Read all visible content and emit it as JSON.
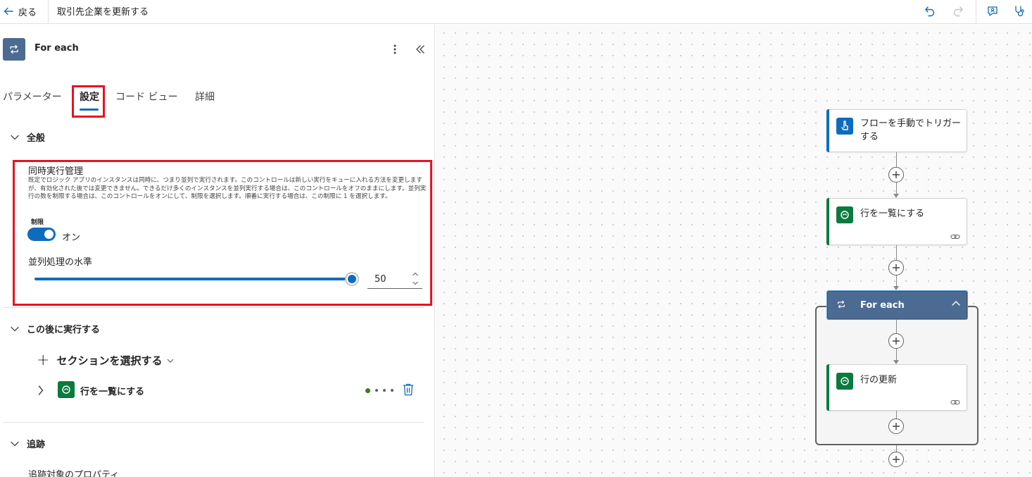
{
  "topbar": {
    "back_label": "戻る",
    "flow_title": "取引先企業を更新する",
    "icons": [
      "undo-icon",
      "redo-icon",
      "feedback-icon",
      "flow-checker-icon"
    ]
  },
  "panel": {
    "action_title": "For each",
    "tabs": [
      {
        "label": "パラメーター"
      },
      {
        "label": "設定"
      },
      {
        "label": "コード ビュー"
      },
      {
        "label": "詳細"
      }
    ],
    "active_tab": "設定",
    "general": {
      "header": "全般",
      "concurrency_title": "同時実行管理",
      "concurrency_desc": "既定でロジック アプリのインスタンスは同時に、つまり並列で実行されます。このコントロールは新しい実行をキューに入れる方法を変更しますが、有効化された後では変更できません。できるだけ多くのインスタンスを並列実行する場合は、このコントロールをオフのままにします。並列実行の数を制限する場合は、このコントロールをオンにして、制限を選択します。順番に実行する場合は、この制限に 1 を選択します。",
      "limit_label": "制限",
      "toggle_state": "オン",
      "toggle_on": true,
      "parallelism_label": "並列処理の水準",
      "parallelism_value": "50",
      "parallelism_fraction": 1.0
    },
    "run_after": {
      "header": "この後に実行する",
      "add_section_label": "セクションを選択する",
      "items": [
        {
          "label": "行を一覧にする"
        }
      ]
    },
    "tracking": {
      "header": "追跡",
      "tracked_properties_label": "追跡対象のプロパティ"
    }
  },
  "canvas": {
    "nodes": {
      "trigger": {
        "label": "フローを手動でトリガーする"
      },
      "list_rows": {
        "label": "行を一覧にする"
      },
      "foreach": {
        "label": "For each"
      },
      "update_row": {
        "label": "行の更新"
      }
    }
  },
  "colors": {
    "accent": "#0f6cbd",
    "highlight": "#e81123",
    "dataverse": "#0b7a3e",
    "foreach": "#4b6b92"
  }
}
